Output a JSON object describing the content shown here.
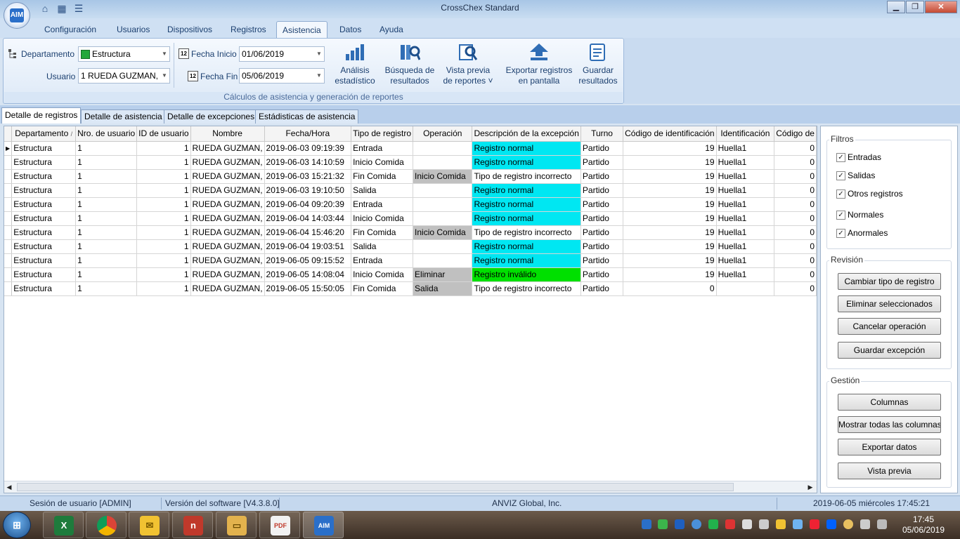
{
  "window": {
    "title": "CrossChex Standard",
    "logo_text": "AIM",
    "min": "▁",
    "max": "❐",
    "close": "✕"
  },
  "ribbon_tabs": [
    "Configuración",
    "Usuarios",
    "Dispositivos",
    "Registros",
    "Asistencia",
    "Datos",
    "Ayuda"
  ],
  "active_ribbon_tab": "Asistencia",
  "filters": {
    "department_label": "Departamento",
    "department_value": "Estructura",
    "user_label": "Usuario",
    "user_value": "1    RUEDA GUZMAN,",
    "start_label": "Fecha Inicio",
    "start_value": "01/06/2019",
    "end_label": "Fecha Fin",
    "end_value": "05/06/2019",
    "calendar_icon_text": "12"
  },
  "ribbon_buttons": [
    {
      "line1": "Análisis",
      "line2": "estadístico"
    },
    {
      "line1": "Búsqueda de",
      "line2": "resultados"
    },
    {
      "line1": "Vista previa",
      "line2": "de reportes ˅"
    },
    {
      "line1": "Exportar registros",
      "line2": "en pantalla"
    },
    {
      "line1": "Guardar",
      "line2": "resultados"
    }
  ],
  "ribbon_group_caption": "Cálculos de asistencia y generación de reportes",
  "doc_tabs": [
    "Detalle de registros",
    "Detalle de asistencia",
    "Detalle de excepciones",
    "Estádisticas de asistencia"
  ],
  "active_doc_tab": "Detalle de registros",
  "table": {
    "columns": [
      "Departamento",
      "Nro. de usuario",
      "ID de usuario",
      "Nombre",
      "Fecha/Hora",
      "Tipo de registro",
      "Operación",
      "Descripción de la excepción",
      "Turno",
      "Código de identificación",
      "Identificación",
      "Código de"
    ],
    "sort_marker": "/",
    "current_row_marker": "▶",
    "rows": [
      [
        "Estructura",
        "1",
        "1",
        "RUEDA GUZMAN,",
        "2019-06-03 09:19:39",
        "Entrada",
        "",
        "Registro normal",
        "Partido",
        "19",
        "Huella1",
        "0"
      ],
      [
        "Estructura",
        "1",
        "1",
        "RUEDA GUZMAN,",
        "2019-06-03 14:10:59",
        "Inicio Comida",
        "",
        "Registro normal",
        "Partido",
        "19",
        "Huella1",
        "0"
      ],
      [
        "Estructura",
        "1",
        "1",
        "RUEDA GUZMAN,",
        "2019-06-03 15:21:32",
        "Fin Comida",
        "Inicio Comida",
        "Tipo de registro incorrecto",
        "Partido",
        "19",
        "Huella1",
        "0"
      ],
      [
        "Estructura",
        "1",
        "1",
        "RUEDA GUZMAN,",
        "2019-06-03 19:10:50",
        "Salida",
        "",
        "Registro normal",
        "Partido",
        "19",
        "Huella1",
        "0"
      ],
      [
        "Estructura",
        "1",
        "1",
        "RUEDA GUZMAN,",
        "2019-06-04 09:20:39",
        "Entrada",
        "",
        "Registro normal",
        "Partido",
        "19",
        "Huella1",
        "0"
      ],
      [
        "Estructura",
        "1",
        "1",
        "RUEDA GUZMAN,",
        "2019-06-04 14:03:44",
        "Inicio Comida",
        "",
        "Registro normal",
        "Partido",
        "19",
        "Huella1",
        "0"
      ],
      [
        "Estructura",
        "1",
        "1",
        "RUEDA GUZMAN,",
        "2019-06-04 15:46:20",
        "Fin Comida",
        "Inicio Comida",
        "Tipo de registro incorrecto",
        "Partido",
        "19",
        "Huella1",
        "0"
      ],
      [
        "Estructura",
        "1",
        "1",
        "RUEDA GUZMAN,",
        "2019-06-04 19:03:51",
        "Salida",
        "",
        "Registro normal",
        "Partido",
        "19",
        "Huella1",
        "0"
      ],
      [
        "Estructura",
        "1",
        "1",
        "RUEDA GUZMAN,",
        "2019-06-05 09:15:52",
        "Entrada",
        "",
        "Registro normal",
        "Partido",
        "19",
        "Huella1",
        "0"
      ],
      [
        "Estructura",
        "1",
        "1",
        "RUEDA GUZMAN,",
        "2019-06-05 14:08:04",
        "Inicio Comida",
        "Eliminar",
        "Registro inválido",
        "Partido",
        "19",
        "Huella1",
        "0"
      ],
      [
        "Estructura",
        "1",
        "1",
        "RUEDA GUZMAN,",
        "2019-06-05 15:50:05",
        "Fin Comida",
        "Salida",
        "Tipo de registro incorrecto",
        "Partido",
        "0",
        "",
        "0"
      ]
    ],
    "highlight_colors": {
      "normal": "#00e7f2",
      "invalid": "#00e000",
      "operation": "#c0c0c0"
    }
  },
  "side": {
    "filters_title": "Filtros",
    "checks": [
      "Entradas",
      "Salidas",
      "Otros registros",
      "Normales",
      "Anormales"
    ],
    "check_mark": "✓",
    "revision_title": "Revisión",
    "revision_buttons": [
      "Cambiar tipo de registro",
      "Eliminar seleccionados",
      "Cancelar operación",
      "Guardar excepción"
    ],
    "gestion_title": "Gestión",
    "gestion_buttons": [
      "Columnas",
      "Mostrar todas las columnas",
      "Exportar datos",
      "Vista previa"
    ]
  },
  "statusbar": {
    "session": "Sesión de usuario  [ADMIN]",
    "version": "Versión del software  [V4.3.8.0]",
    "company": "ANVIZ Global, Inc.",
    "datetime": "2019-06-05 miércoles 17:45:21"
  },
  "taskbar": {
    "time": "17:45",
    "date": "05/06/2019",
    "apps": [
      "excel-icon",
      "chrome-icon",
      "outlook-icon",
      "nitro-icon",
      "explorer-icon",
      "pdf-icon",
      "crosschex-icon"
    ]
  }
}
